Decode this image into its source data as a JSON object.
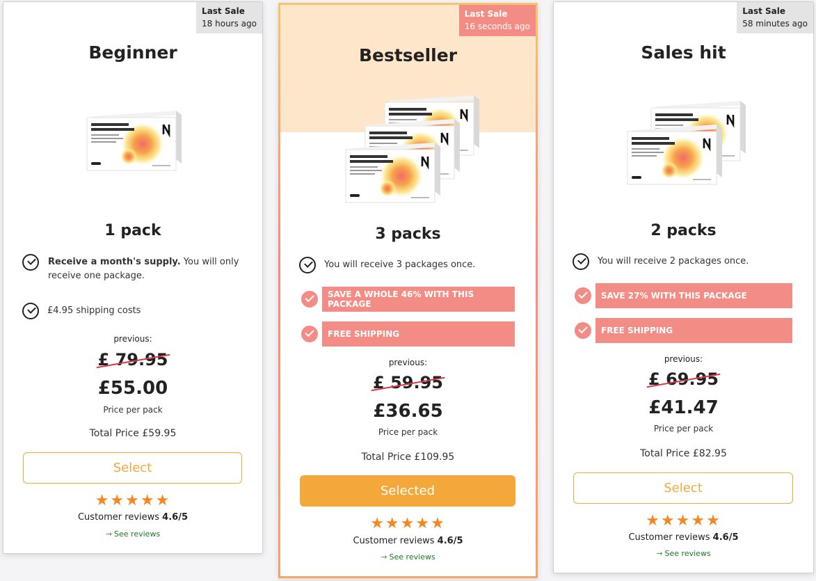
{
  "colors": {
    "accent": "#f4a83a",
    "promo": "#f38c84",
    "star": "#f6861f",
    "strike": "#d8394a",
    "link": "#1a7a23",
    "highlight_bg": "#fde6c9"
  },
  "cards": [
    {
      "badge_title": "Last Sale",
      "badge_time": "18 hours ago",
      "title": "Beginner",
      "product_box_label": "Macronutrient Metabolism Support",
      "packs": "1 pack",
      "feature1_bold": "Receive a month's supply.",
      "feature1_rest": " You will only receive one package.",
      "feature2": "£4.95 shipping costs",
      "previous_label": "previous:",
      "old_price": "£ 79.95",
      "price": "£55.00",
      "price_per_pack": "Price per pack",
      "total": "Total Price £59.95",
      "button": "Select",
      "stars": "★★★★★",
      "reviews_label": "Customer reviews",
      "rating": "4.6/5",
      "see_reviews": "See reviews",
      "arrow_icon": "→"
    },
    {
      "badge_title": "Last Sale",
      "badge_time": "16 seconds ago",
      "title": "Bestseller",
      "product_box_label": "Macronutrient Metabolism Support",
      "packs": "3 packs",
      "feature1": "You will receive 3 packages once.",
      "promo1": "SAVE A WHOLE 46% WITH THIS PACKAGE",
      "promo2": "FREE SHIPPING",
      "previous_label": "previous:",
      "old_price": "£ 59.95",
      "price": "£36.65",
      "price_per_pack": "Price per pack",
      "total": "Total Price £109.95",
      "button": "Selected",
      "stars": "★★★★★",
      "reviews_label": "Customer reviews",
      "rating": "4.6/5",
      "see_reviews": "See reviews",
      "arrow_icon": "→"
    },
    {
      "badge_title": "Last Sale",
      "badge_time": "58 minutes ago",
      "title": "Sales hit",
      "product_box_label": "Macronutrient Metabolism Support",
      "packs": "2 packs",
      "feature1": "You will receive 2 packages once.",
      "promo1": "SAVE 27% WITH THIS PACKAGE",
      "promo2": "FREE SHIPPING",
      "previous_label": "previous:",
      "old_price": "£ 69.95",
      "price": "£41.47",
      "price_per_pack": "Price per pack",
      "total": "Total Price £82.95",
      "button": "Select",
      "stars": "★★★★★",
      "reviews_label": "Customer reviews",
      "rating": "4.6/5",
      "see_reviews": "See reviews",
      "arrow_icon": "→"
    }
  ]
}
